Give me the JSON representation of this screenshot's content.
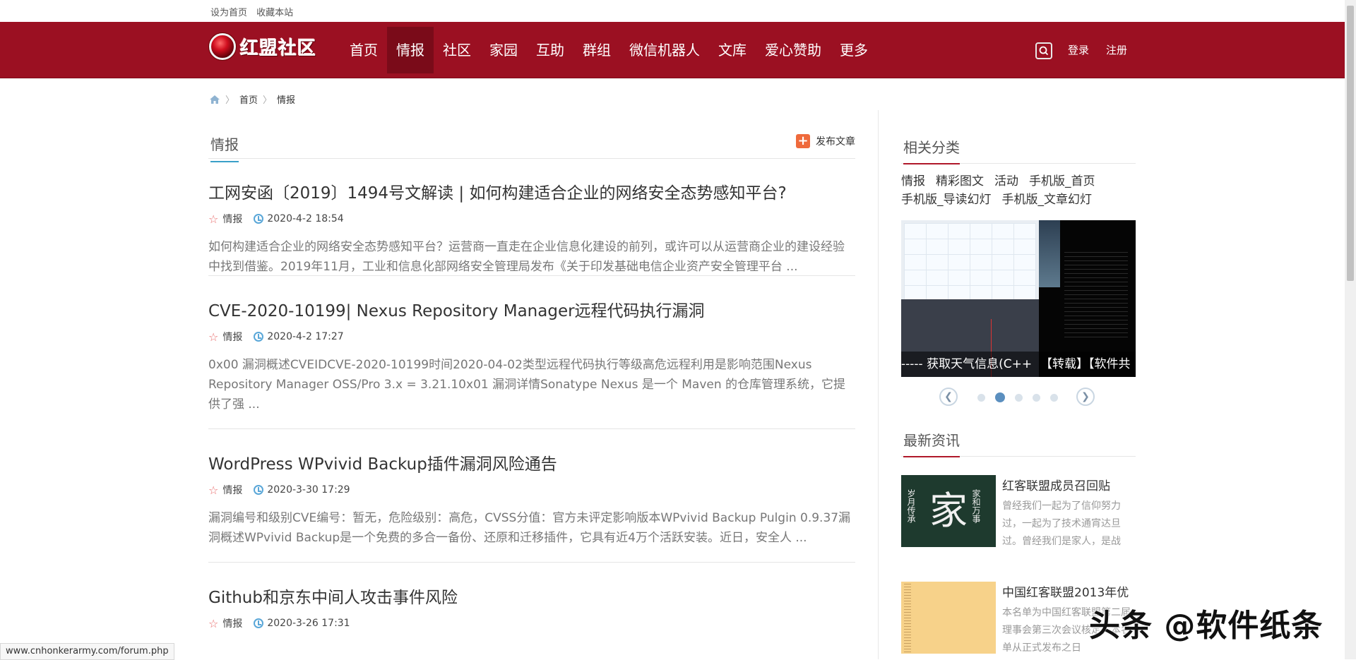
{
  "topbar": {
    "set_home": "设为首页",
    "bookmark": "收藏本站"
  },
  "header": {
    "logo_text": "红盟社区",
    "nav": [
      "首页",
      "情报",
      "社区",
      "家园",
      "互助",
      "群组",
      "微信机器人",
      "文库",
      "爱心赞助",
      "更多"
    ],
    "active_nav": "情报",
    "login": "登录",
    "register": "注册",
    "brand_color": "#9b1022"
  },
  "breadcrumb": {
    "home": "首页",
    "current": "情报"
  },
  "main": {
    "section_title": "情报",
    "publish_label": "发布文章",
    "articles": [
      {
        "title": "工网安函〔2019〕1494号文解读 | 如何构建适合企业的网络安全态势感知平台?",
        "category": "情报",
        "date": "2020-4-2 18:54",
        "summary": "如何构建适合企业的网络安全态势感知平台？运营商一直走在企业信息化建设的前列，或许可以从运营商企业的建设经验中找到借鉴。2019年11月，工业和信息化部网络安全管理局发布《关于印发基础电信企业资产安全管理平台 ..."
      },
      {
        "title": "CVE-2020-10199| Nexus Repository Manager远程代码执行漏洞",
        "category": "情报",
        "date": "2020-4-2 17:27",
        "summary": "0x00 漏洞概述CVEIDCVE-2020-10199时间2020-04-02类型远程代码执行等级高危远程利用是影响范围Nexus Repository Manager OSS/Pro 3.x = 3.21.10x01 漏洞详情Sonatype Nexus 是一个 Maven 的仓库管理系统，它提供了强 ..."
      },
      {
        "title": "WordPress WPvivid Backup插件漏洞风险通告",
        "category": "情报",
        "date": "2020-3-30 17:29",
        "summary": "漏洞编号和级别CVE编号：暂无，危险级别：高危，CVSS分值：官方未评定影响版本WPvivid Backup Pulgin 0.9.37漏洞概述WPvivid Backup是一个免费的多合一备份、还原和迁移插件，它具有近4万个活跃安装。近日，安全人 ..."
      },
      {
        "title": "Github和京东中间人攻击事件风险",
        "category": "情报",
        "date": "2020-3-26 17:31",
        "summary": ""
      }
    ]
  },
  "sidebar": {
    "related_title": "相关分类",
    "categories": [
      "情报",
      "精彩图文",
      "活动",
      "手机版_首页",
      "手机版_导读幻灯",
      "手机版_文章幻灯"
    ],
    "slider": {
      "caption_1": "----- 获取天气信息(C++",
      "caption_2": "【转载】【软件共",
      "dot_count": 5,
      "active_dot": 2,
      "prev": "❮",
      "next": "❯"
    },
    "news_title": "最新资讯",
    "news": [
      {
        "title": "红客联盟成员召回贴",
        "desc": "曾经我们一起为了信仰努力过，一起为了技术通宵达旦过。曾经我们是家人，是战",
        "thumb_big": "家",
        "thumb_left": "岁月传承",
        "thumb_right": "家和万事"
      },
      {
        "title": "中国红客联盟2013年优",
        "desc": "本名单为中国红客联盟第二届理事会第三次会议核定，本名单从正式发布之日"
      }
    ]
  },
  "statusbar": {
    "url": "www.cnhonkerarmy.com/forum.php"
  },
  "watermark": "头条 @软件纸条"
}
